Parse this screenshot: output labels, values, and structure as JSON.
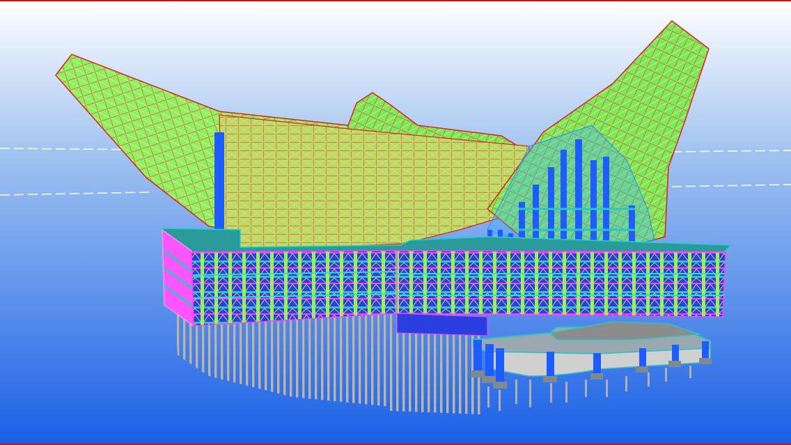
{
  "viewport": {
    "background_top": "#ffffff",
    "background_mid": "#9fc2f0",
    "background_bottom": "#1a5fe6",
    "frame_color": "#d01010"
  },
  "model": {
    "roof_mesh_color": "#44ff44",
    "roof_edge_color": "#ff2222",
    "bracing_color": "#ffff44",
    "column_color": "#1d5cff",
    "slab_color": "#22a3a3",
    "beam_color": "#ff33ff",
    "pile_color": "#b0b0b0",
    "annex_slab_color": "#c8c8c8",
    "dashed_reference_color": "#ffffff"
  }
}
